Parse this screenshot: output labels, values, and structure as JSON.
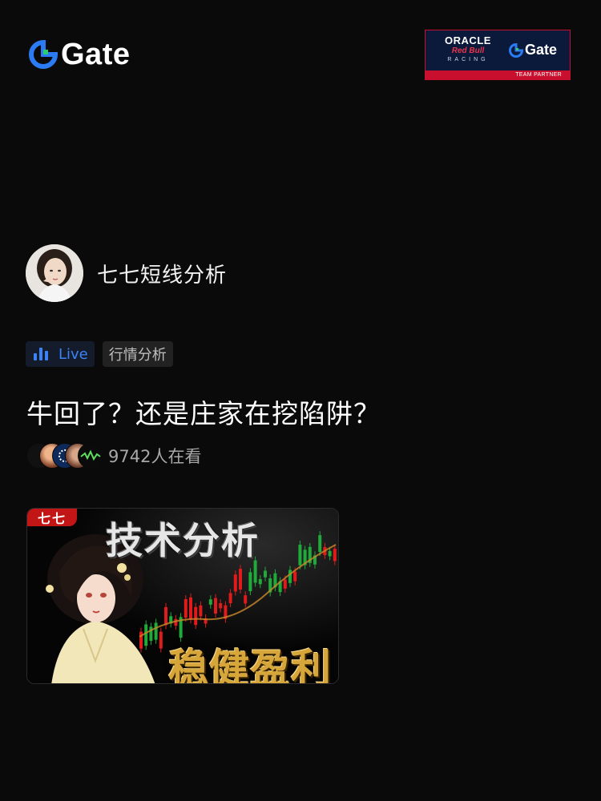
{
  "brand": {
    "name": "Gate",
    "icon": "gate-logo-icon",
    "accent": "#2b7bf5"
  },
  "partner_badge": {
    "line1": "ORACLE",
    "line2": "Red Bull",
    "line3": "RACING",
    "brand": "Gate",
    "strip": "TEAM PARTNER",
    "colors": {
      "bg": "#0b1a3a",
      "red": "#c8102e"
    }
  },
  "author": {
    "name": "七七短线分析",
    "avatar": "streamer-avatar"
  },
  "tags": {
    "live": "Live",
    "category": "行情分析",
    "live_color": "#3b82f6"
  },
  "stream": {
    "title": "牛回了？还是庄家在挖陷阱？",
    "viewer_count": "9742",
    "viewer_suffix": "人在看"
  },
  "thumbnail": {
    "badge": "七七",
    "headline": "技术分析",
    "tagline": "稳健盈利"
  }
}
